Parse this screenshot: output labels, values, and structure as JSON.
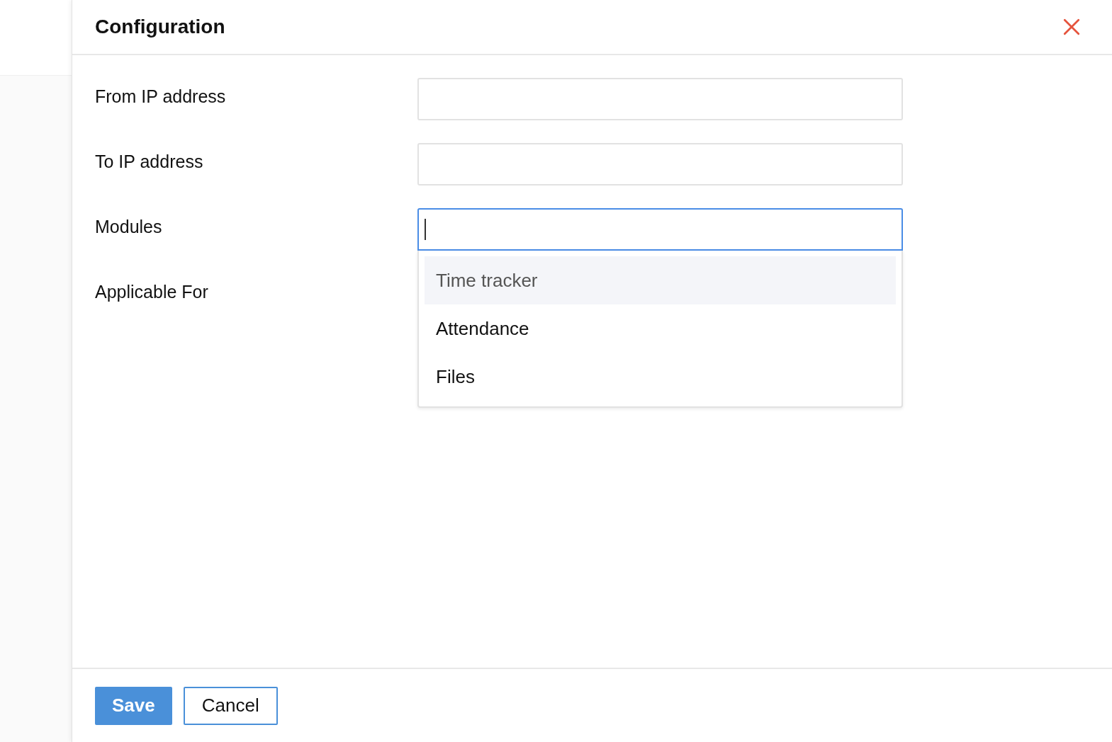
{
  "dialog": {
    "title": "Configuration"
  },
  "fields": [
    {
      "label": "From IP address",
      "kind": "input"
    },
    {
      "label": "To IP address",
      "kind": "input"
    },
    {
      "label": "Modules",
      "kind": "input",
      "focused": true
    },
    {
      "label": "Applicable For",
      "kind": "none"
    }
  ],
  "dropdown": {
    "options": [
      {
        "label": "Time tracker",
        "highlighted": true
      },
      {
        "label": "Attendance",
        "highlighted": false
      },
      {
        "label": "Files",
        "highlighted": false
      }
    ]
  },
  "buttons": [
    {
      "label": "Save",
      "kind": "primary"
    },
    {
      "label": "Cancel",
      "kind": "secondary"
    }
  ]
}
